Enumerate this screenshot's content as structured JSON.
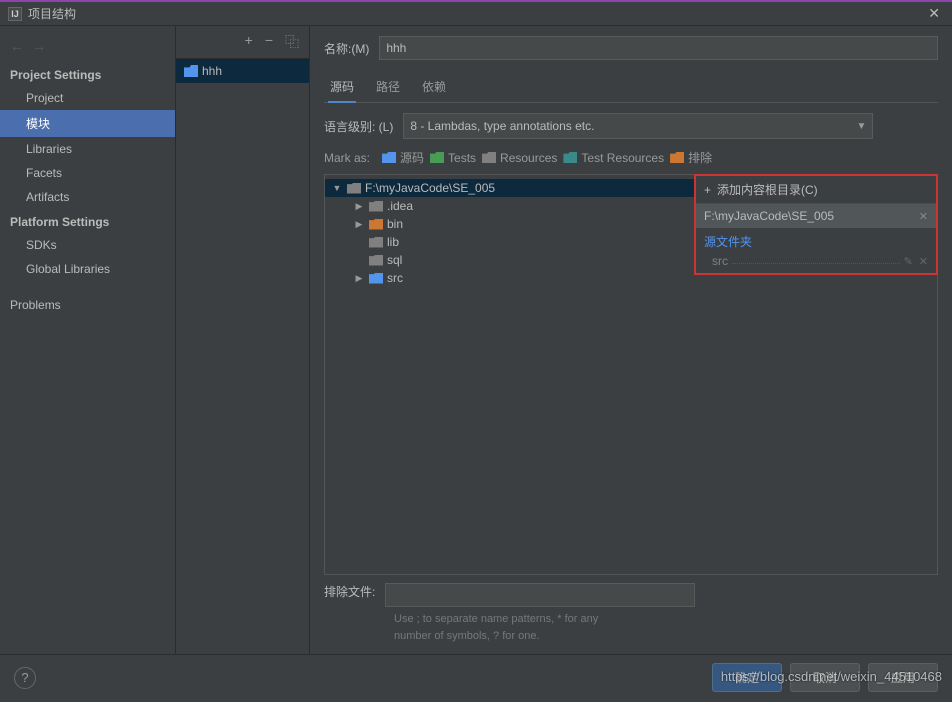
{
  "window": {
    "title": "项目结构",
    "icon_letter": "IJ"
  },
  "sidebar": {
    "section1": "Project Settings",
    "items1": [
      "Project",
      "模块",
      "Libraries",
      "Facets",
      "Artifacts"
    ],
    "selected": "模块",
    "section2": "Platform Settings",
    "items2": [
      "SDKs",
      "Global Libraries"
    ],
    "problems": "Problems"
  },
  "modlist": {
    "module": "hhh"
  },
  "content": {
    "name_label": "名称:(M)",
    "name_value": "hhh",
    "tabs": [
      "源码",
      "路径",
      "依赖"
    ],
    "lang_label": "语言级别: (L)",
    "lang_value": "8 - Lambdas, type annotations etc.",
    "mark_label": "Mark as:",
    "marks": [
      {
        "label": "源码",
        "color": "fi-blue"
      },
      {
        "label": "Tests",
        "color": "fi-green"
      },
      {
        "label": "Resources",
        "color": "fi-gray"
      },
      {
        "label": "Test Resources",
        "color": "fi-teal"
      },
      {
        "label": "排除",
        "color": "fi-orange"
      }
    ],
    "tree": {
      "root": "F:\\myJavaCode\\SE_005",
      "children": [
        {
          "name": ".idea",
          "color": "fi-gray",
          "exp": true
        },
        {
          "name": "bin",
          "color": "fi-orange",
          "exp": true
        },
        {
          "name": "lib",
          "color": "fi-gray",
          "exp": false
        },
        {
          "name": "sql",
          "color": "fi-gray",
          "exp": false
        },
        {
          "name": "src",
          "color": "fi-blue",
          "exp": true
        }
      ]
    },
    "rightpanel": {
      "header": "添加内容根目录(C)",
      "path": "F:\\myJavaCode\\SE_005",
      "section": "源文件夹",
      "item": "src"
    },
    "exclude_label": "排除文件:",
    "hint1": "Use ; to separate name patterns, * for any",
    "hint2": "number of symbols, ? for one."
  },
  "footer": {
    "ok": "确定",
    "cancel": "取消",
    "apply": "应用"
  },
  "watermark": "https://blog.csdn.net/weixin_44510468"
}
